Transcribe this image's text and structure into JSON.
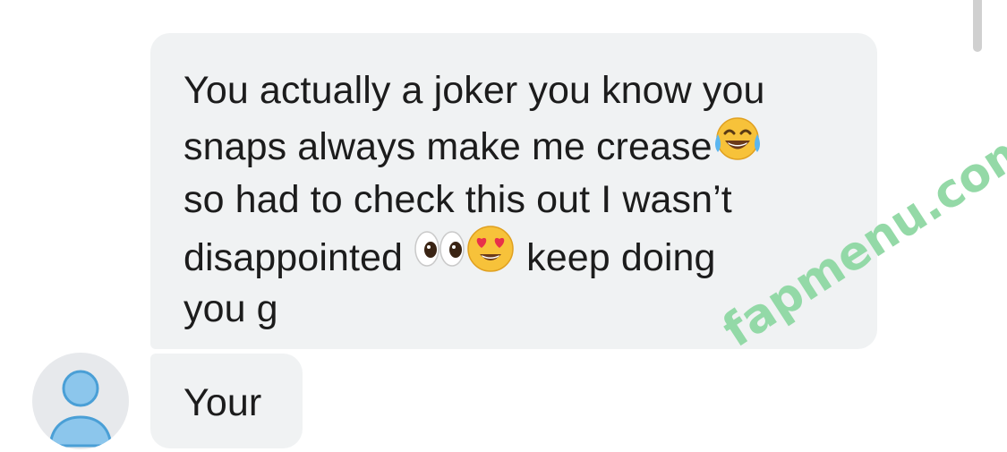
{
  "messages": [
    {
      "lines": [
        "You actually a joker you know you",
        "snaps always make me crease",
        "so had to check this out I wasn’t",
        "disappointed",
        "keep doing",
        "you g"
      ],
      "emojis": [
        "face-with-tears-of-joy",
        "eyes",
        "smiling-face-with-heart-eyes"
      ]
    },
    {
      "text": "Your"
    }
  ],
  "watermark": "fapmenu.com",
  "colors": {
    "bubble": "#f0f2f3",
    "text": "#1c1c1c",
    "avatar_bg": "#e7e9ec",
    "avatar_icon": "#8cc6ec",
    "watermark": "#8fd8a3"
  }
}
